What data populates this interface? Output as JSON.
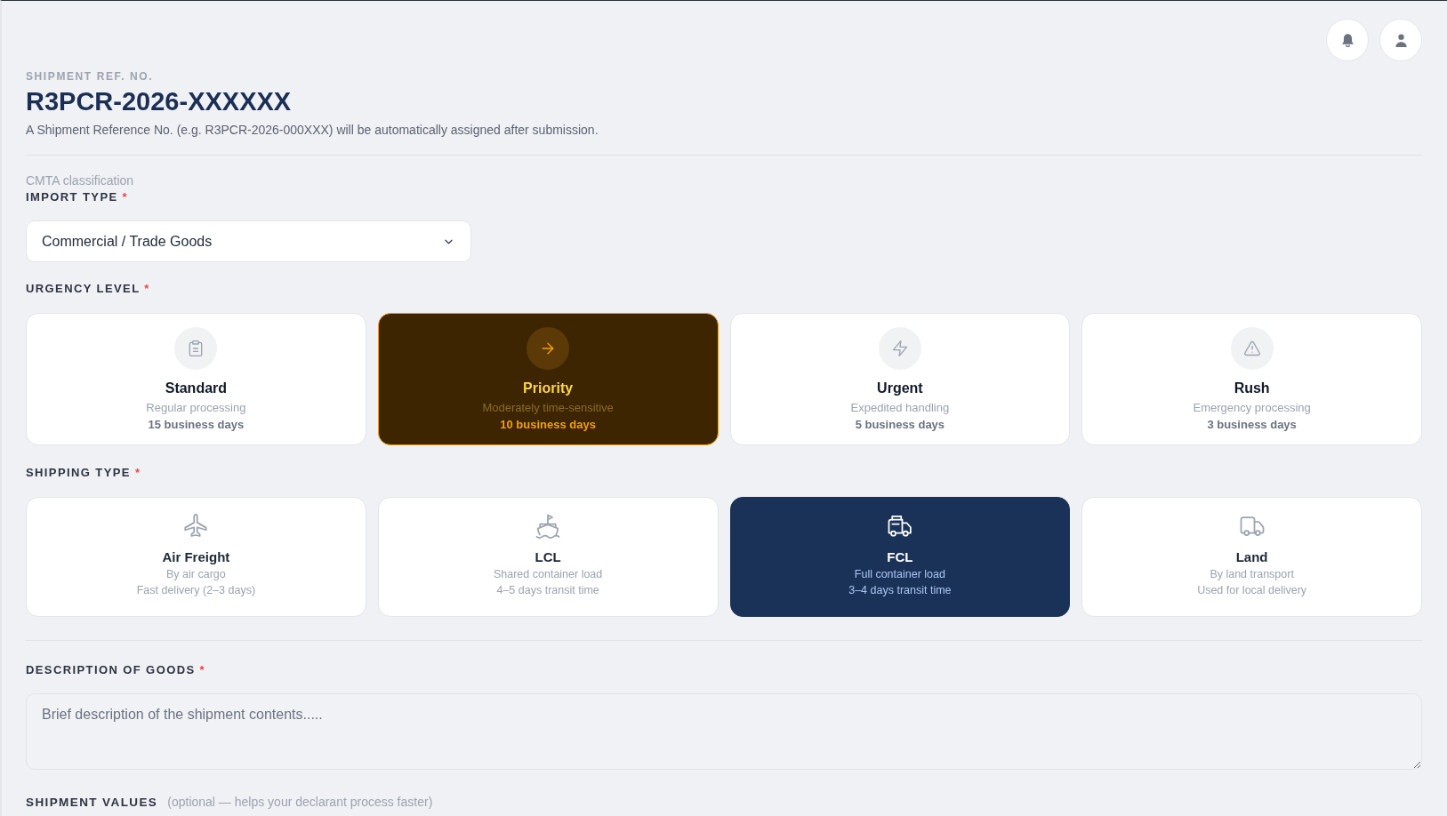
{
  "shipment_ref": {
    "label": "SHIPMENT REF. NO.",
    "value": "R3PCR-2026-XXXXXX",
    "note": "A Shipment Reference No. (e.g. R3PCR-2026-000XXX) will be automatically assigned after submission."
  },
  "import_type": {
    "caption": "CMTA classification",
    "label": "IMPORT TYPE",
    "required_mark": "*",
    "value": "Commercial / Trade Goods"
  },
  "urgency_level": {
    "label": "URGENCY LEVEL",
    "required_mark": "*",
    "options": [
      {
        "title": "Standard",
        "description": "Regular processing",
        "duration": "15 business days",
        "selected": false
      },
      {
        "title": "Priority",
        "description": "Moderately time-sensitive",
        "duration": "10 business days",
        "selected": true
      },
      {
        "title": "Urgent",
        "description": "Expedited handling",
        "duration": "5 business days",
        "selected": false
      },
      {
        "title": "Rush",
        "description": "Emergency processing",
        "duration": "3 business days",
        "selected": false
      }
    ]
  },
  "shipping_type": {
    "label": "SHIPPING TYPE",
    "required_mark": "*",
    "options": [
      {
        "title": "Air Freight",
        "line_1": "By air cargo",
        "line_2": "Fast delivery (2–3 days)",
        "selected": false
      },
      {
        "title": "LCL",
        "line_1": "Shared container load",
        "line_2": "4–5 days transit time",
        "selected": false
      },
      {
        "title": "FCL",
        "line_1": "Full container load",
        "line_2": "3–4 days transit time",
        "selected": true
      },
      {
        "title": "Land",
        "line_1": "By land transport",
        "line_2": "Used for local delivery",
        "selected": false
      }
    ]
  },
  "description_of_goods": {
    "label": "DESCRIPTION OF GOODS",
    "required_mark": "*",
    "placeholder": "Brief description of the shipment contents....."
  },
  "shipment_values": {
    "label": "SHIPMENT VALUES",
    "hint": "(optional — helps your declarant process faster)"
  }
}
